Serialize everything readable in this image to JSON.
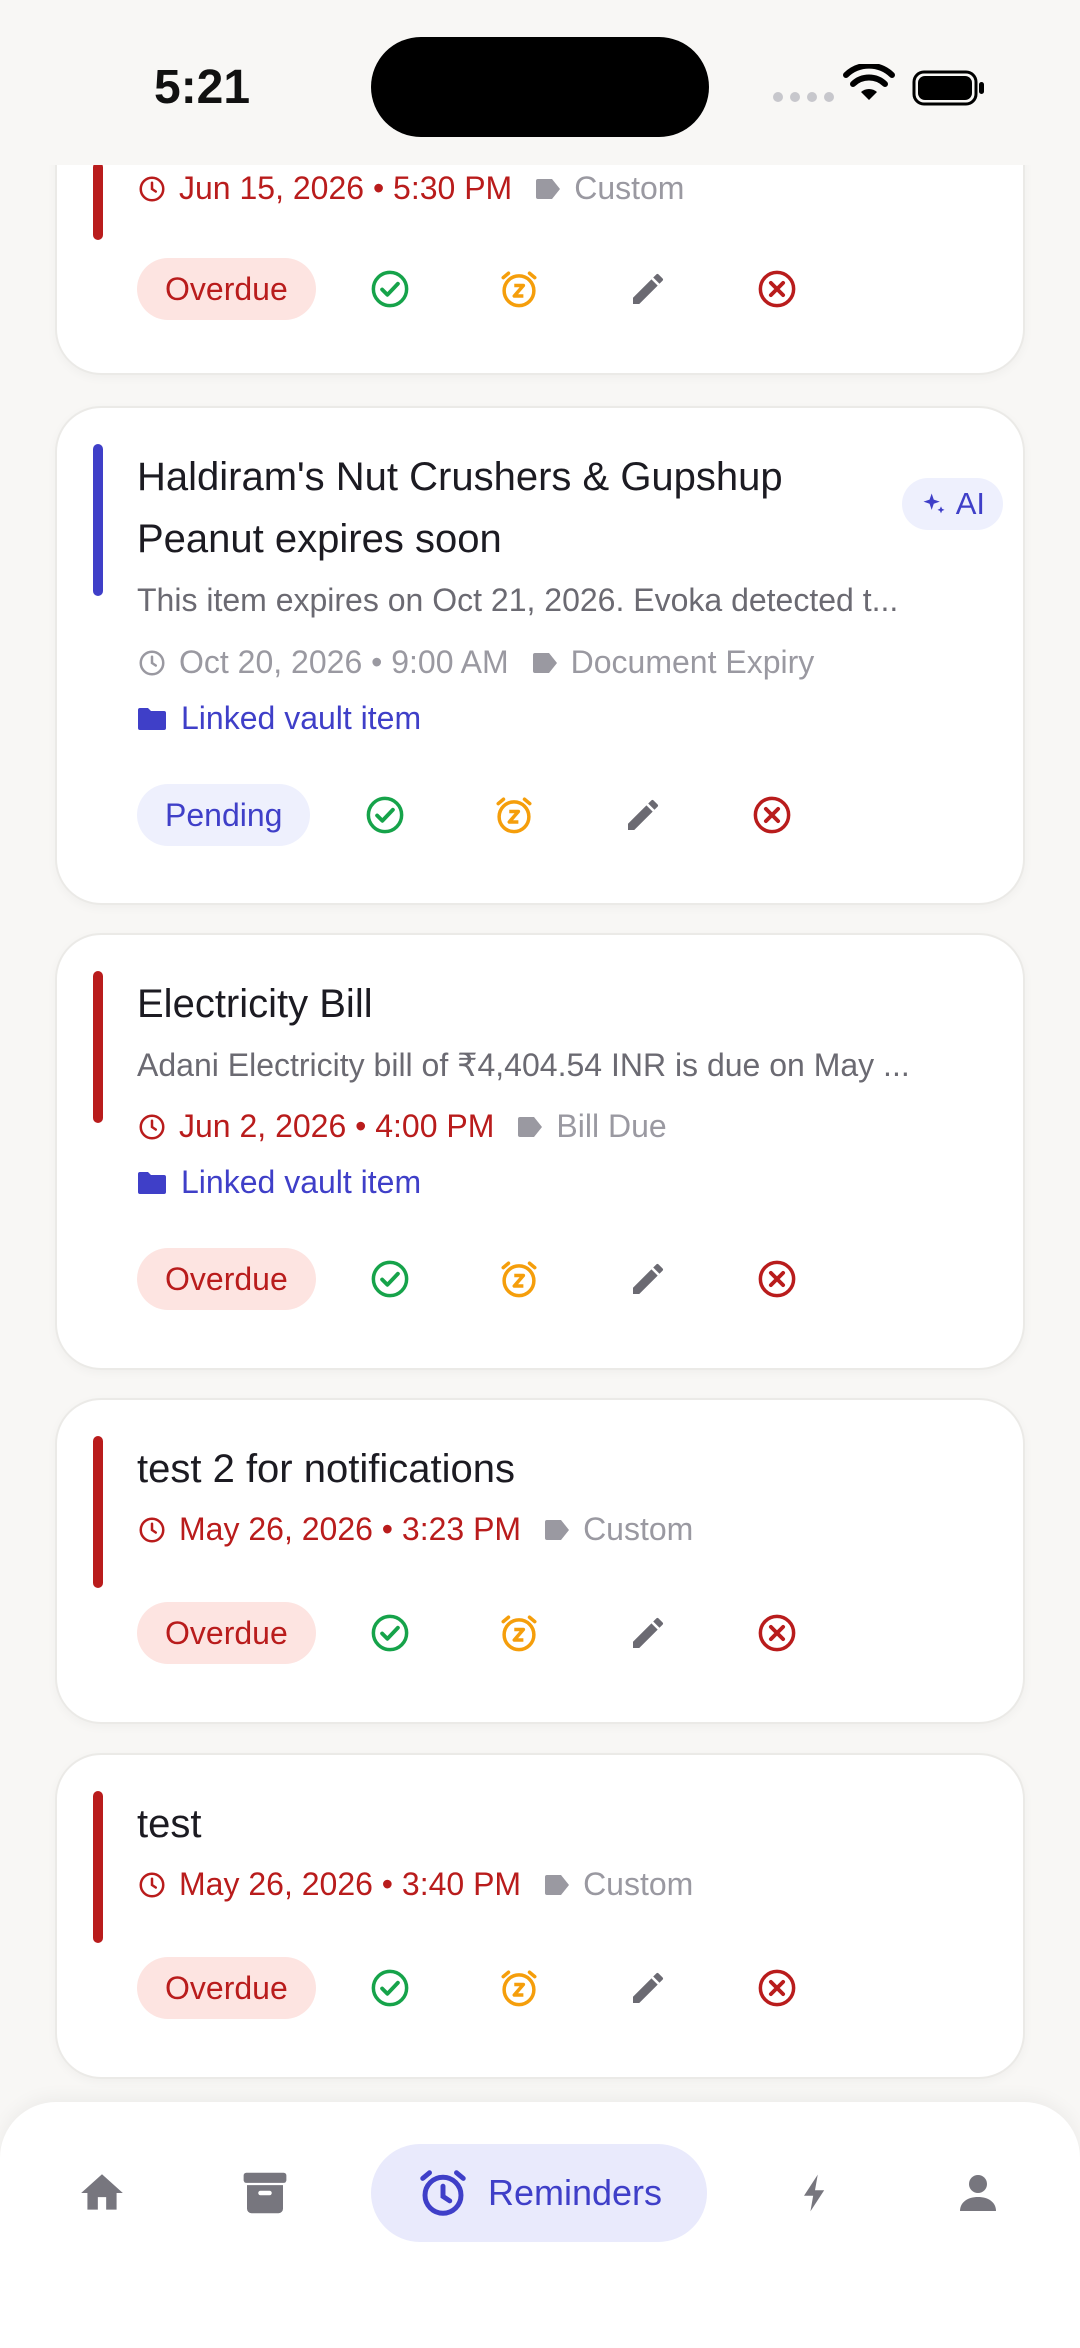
{
  "status_bar": {
    "time": "5:21"
  },
  "colors": {
    "overdue_red": "#b91c1c",
    "brand_indigo": "#3f3fc8",
    "done_green": "#16a34a",
    "snooze_orange": "#f59e0b",
    "edit_gray": "#6b6a72"
  },
  "cards": [
    {
      "title": "",
      "when": "Jun 15, 2026 • 5:30 PM",
      "category": "Custom",
      "status": "Overdue"
    },
    {
      "title": "Haldiram's Nut Crushers & Gupshup Peanut expires soon",
      "ai_badge": "AI",
      "description": "This item expires on Oct 21, 2026. Evoka detected t...",
      "when": "Oct 20, 2026 • 9:00 AM",
      "category": "Document Expiry",
      "vault_link": "Linked vault item",
      "status": "Pending"
    },
    {
      "title": "Electricity Bill",
      "description": "Adani Electricity bill of ₹4,404.54 INR is due on May ...",
      "when": "Jun 2, 2026 • 4:00 PM",
      "category": "Bill Due",
      "vault_link": "Linked vault item",
      "status": "Overdue"
    },
    {
      "title": "test 2 for notifications",
      "when": "May 26, 2026 • 3:23 PM",
      "category": "Custom",
      "status": "Overdue"
    },
    {
      "title": "test",
      "when": "May 26, 2026 • 3:40 PM",
      "category": "Custom",
      "status": "Overdue"
    }
  ],
  "icons": {
    "done": "check-circle-icon",
    "snooze": "snooze-alarm-icon",
    "edit": "pencil-icon",
    "dismiss": "x-circle-icon",
    "ai": "sparkle-icon",
    "vault": "folder-icon",
    "time": "clock-icon",
    "category": "tag-icon"
  },
  "nav": {
    "items": [
      "home",
      "vault",
      "reminders",
      "actions",
      "profile"
    ],
    "active_label": "Reminders"
  }
}
